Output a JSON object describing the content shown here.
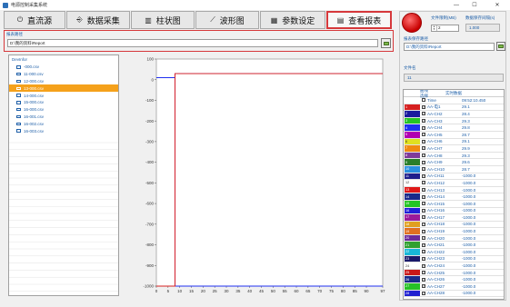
{
  "window": {
    "title": "电源控制采集系统"
  },
  "tabs": [
    {
      "label": "直流源",
      "icon": "power-icon"
    },
    {
      "label": "数据采集",
      "icon": "usb-icon"
    },
    {
      "label": "柱状图",
      "icon": "bar-chart-icon"
    },
    {
      "label": "波形图",
      "icon": "line-chart-icon"
    },
    {
      "label": "参数设定",
      "icon": "table-icon"
    },
    {
      "label": "查看报表",
      "icon": "document-icon",
      "active": true
    }
  ],
  "report_path": {
    "label": "报表路径",
    "value": "D:\\我的资料\\Report"
  },
  "tree": {
    "root": "DevInfor",
    "items": [
      "-000.csv",
      "11-000.csv",
      "12-000.csv",
      "13-000.csv",
      "14-000.csv",
      "15-000.csv",
      "16-000.csv",
      "16-001.csv",
      "16-002.csv",
      "16-003.csv"
    ],
    "selected_index": 3
  },
  "right_panel": {
    "file_limit_label": "文件限制(MB)",
    "file_limit_value": "2",
    "rate_label": "数据保存间隔(s)",
    "rate_value": "1.000",
    "save_path_label": "报表保存路径",
    "save_path_value": "D:\\我的资料\\Report",
    "file_name_label": "文件名",
    "file_name_value": "11",
    "table_headers": {
      "color": "曲线选择",
      "value": "实时数据"
    },
    "channels": [
      {
        "swatch": "",
        "color": "#ffffff",
        "name": "Time",
        "value": "09:52:10.450",
        "checked": false
      },
      {
        "swatch": "1",
        "color": "#d62020",
        "name": "AA-电1",
        "value": "29.1",
        "checked": true
      },
      {
        "swatch": "2",
        "color": "#1a1a9e",
        "name": "AA-CH2",
        "value": "28.4",
        "checked": true
      },
      {
        "swatch": "3",
        "color": "#25c425",
        "name": "AA-CH3",
        "value": "29.3",
        "checked": true
      },
      {
        "swatch": "4",
        "color": "#1f2ff0",
        "name": "AA-CH4",
        "value": "29.8",
        "checked": true
      },
      {
        "swatch": "5",
        "color": "#b200b2",
        "name": "AA-CH5",
        "value": "28.7",
        "checked": true
      },
      {
        "swatch": "6",
        "color": "#e0e020",
        "name": "AA-CH6",
        "value": "29.1",
        "checked": true
      },
      {
        "swatch": "7",
        "color": "#f08a10",
        "name": "AA-CH7",
        "value": "29.9",
        "checked": true
      },
      {
        "swatch": "8",
        "color": "#7f3a9a",
        "name": "AA-CH8",
        "value": "29.3",
        "checked": true
      },
      {
        "swatch": "9",
        "color": "#2a7e2a",
        "name": "AA-CH9",
        "value": "29.6",
        "checked": true
      },
      {
        "swatch": "10",
        "color": "#2a90e0",
        "name": "AA-CH10",
        "value": "28.7",
        "checked": true
      },
      {
        "swatch": "11",
        "color": "#1e1e8c",
        "name": "AA-CH11",
        "value": "-1000.0",
        "checked": true
      },
      {
        "swatch": "12",
        "color": "#ffffff",
        "name": "AA-CH12",
        "value": "-1000.0",
        "checked": true
      },
      {
        "swatch": "13",
        "color": "#e01818",
        "name": "AA-CH13",
        "value": "-1000.0",
        "checked": true
      },
      {
        "swatch": "14",
        "color": "#1a2a8a",
        "name": "AA-CH14",
        "value": "-1000.0",
        "checked": true
      },
      {
        "swatch": "15",
        "color": "#24c424",
        "name": "AA-CH15",
        "value": "-1000.0",
        "checked": true
      },
      {
        "swatch": "16",
        "color": "#2020d8",
        "name": "AA-CH16",
        "value": "-1000.0",
        "checked": true
      },
      {
        "swatch": "17",
        "color": "#9a1a9a",
        "name": "AA-CH17",
        "value": "-1000.0",
        "checked": true
      },
      {
        "swatch": "18",
        "color": "#e0a020",
        "name": "AA-CH18",
        "value": "-1000.0",
        "checked": true
      },
      {
        "swatch": "19",
        "color": "#e07020",
        "name": "AA-CH19",
        "value": "-1000.0",
        "checked": true
      },
      {
        "swatch": "20",
        "color": "#6a2a9a",
        "name": "AA-CH20",
        "value": "-1000.0",
        "checked": true
      },
      {
        "swatch": "21",
        "color": "#30a030",
        "name": "AA-CH21",
        "value": "-1000.0",
        "checked": true
      },
      {
        "swatch": "22",
        "color": "#18b8d8",
        "name": "AA-CH22",
        "value": "-1000.0",
        "checked": true
      },
      {
        "swatch": "23",
        "color": "#1a1a6a",
        "name": "AA-CH23",
        "value": "-1000.0",
        "checked": true
      },
      {
        "swatch": "24",
        "color": "#ffffff",
        "name": "AA-CH24",
        "value": "-1000.0",
        "checked": true
      },
      {
        "swatch": "25",
        "color": "#c81818",
        "name": "AA-CH25",
        "value": "-1000.0",
        "checked": true
      },
      {
        "swatch": "26",
        "color": "#1a2a8a",
        "name": "AA-CH26",
        "value": "-1000.0",
        "checked": true
      },
      {
        "swatch": "27",
        "color": "#26c026",
        "name": "AA-CH27",
        "value": "-1000.0",
        "checked": true
      },
      {
        "swatch": "28",
        "color": "#2020d0",
        "name": "AA-CH28",
        "value": "-1000.0",
        "checked": true
      }
    ]
  },
  "chart_data": {
    "type": "line",
    "y_ticks": [
      "100",
      "0",
      "-100",
      "-200",
      "-300",
      "-400",
      "-500",
      "-600",
      "-700",
      "-800",
      "-900",
      "-1000"
    ],
    "x_ticks": [
      "0",
      "5",
      "10",
      "15",
      "20",
      "25",
      "30",
      "35",
      "40",
      "45",
      "50",
      "55",
      "60",
      "65",
      "70",
      "75",
      "80",
      "85",
      "90",
      "97"
    ],
    "ylim": [
      -1000,
      100
    ],
    "xlim": [
      0,
      97
    ],
    "series": [
      {
        "color": "#1f2ff0",
        "x": [
          0,
          8,
          8,
          97
        ],
        "y": [
          10,
          10,
          -1000,
          -1000
        ]
      },
      {
        "color": "#25c425",
        "x": [
          0,
          8,
          8,
          97
        ],
        "y": [
          -1000,
          -1000,
          29,
          29
        ]
      },
      {
        "color": "#b200b2",
        "x": [
          0,
          8,
          8,
          97
        ],
        "y": [
          -1000,
          -1000,
          29,
          29
        ]
      },
      {
        "color": "#d62020",
        "x": [
          0,
          8,
          8,
          97
        ],
        "y": [
          -1000,
          -1000,
          29,
          29
        ]
      }
    ]
  }
}
